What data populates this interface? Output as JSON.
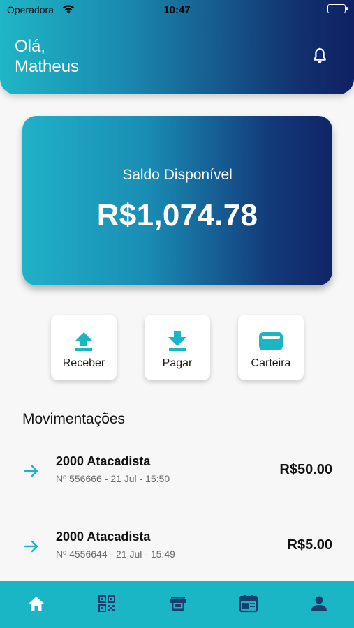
{
  "status_bar": {
    "carrier": "Operadora",
    "time": "10:47"
  },
  "header": {
    "greeting_line1": "Olá,",
    "greeting_line2": "Matheus",
    "bell_icon": "bell-icon"
  },
  "balance": {
    "label": "Saldo Disponível",
    "value": "R$1,074.78"
  },
  "actions": [
    {
      "label": "Receber",
      "icon": "upload-icon"
    },
    {
      "label": "Pagar",
      "icon": "download-icon"
    },
    {
      "label": "Carteira",
      "icon": "wallet-icon"
    }
  ],
  "transactions_title": "Movimentações",
  "transactions": [
    {
      "name": "2000 Atacadista",
      "meta": "Nº 556666 - 21 Jul - 15:50",
      "amount": "R$50.00"
    },
    {
      "name": "2000 Atacadista",
      "meta": "Nº 4556644 - 21 Jul - 15:49",
      "amount": "R$5.00"
    }
  ],
  "bottom_nav": [
    "home-icon",
    "qr-code-icon",
    "store-icon",
    "calendar-icon",
    "profile-icon"
  ],
  "colors": {
    "accent": "#1ab6c5",
    "navy": "#0f2163",
    "background": "#f7f7f8"
  }
}
